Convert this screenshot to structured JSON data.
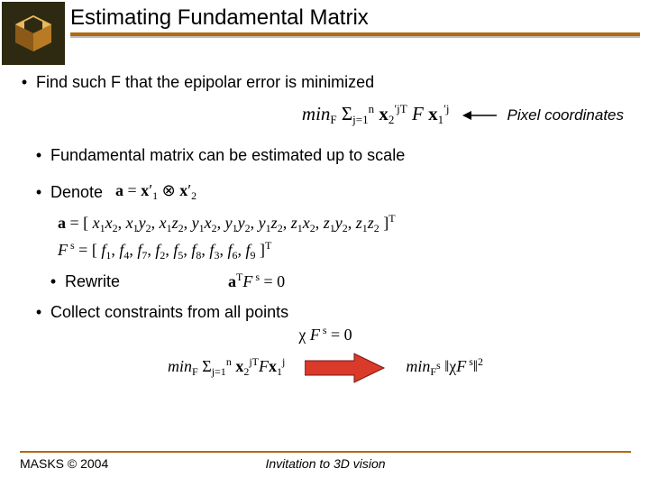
{
  "title": "Estimating Fundamental Matrix",
  "bullets": {
    "b1": "Find such F that the epipolar error is minimized",
    "b2": "Fundamental matrix can be estimated up to scale",
    "b3": "Denote",
    "b4": "Rewrite",
    "b5": "Collect constraints from all points"
  },
  "annotations": {
    "pixel_coords": "Pixel coordinates"
  },
  "equations": {
    "minF_label": "min",
    "sum_n": "n",
    "sum_j": "j=1",
    "x2_prime_jT": "x₂",
    "F": "F",
    "x1_prime_j": "x₁",
    "a_eq": "a = x′₁ ⊗ x′₂",
    "a_vec": "a = [ x₁x₂, x₁y₂, x₁z₂, y₁x₂, y₁y₂, y₁z₂, z₁x₂, z₁y₂, z₁z₂ ]",
    "Fs_vec": "F",
    "Fs_components": " = [ f₁, f₄, f₇, f₂, f₅, f₈, f₃, f₆, f₉ ]",
    "a_T_Fs": "a",
    "Fs_zero": " = 0",
    "chi_Fs": "χ F",
    "minF_sum2": "min",
    "minFs_norm": "min",
    "chi": "χ",
    "norm_sq": "²"
  },
  "footer": {
    "left": "MASKS © 2004",
    "center": "Invitation to 3D vision"
  },
  "icons": {
    "logo": "cube-logo-icon",
    "arrow_left": "arrow-left-icon",
    "block_arrow": "block-arrow-right-icon"
  }
}
